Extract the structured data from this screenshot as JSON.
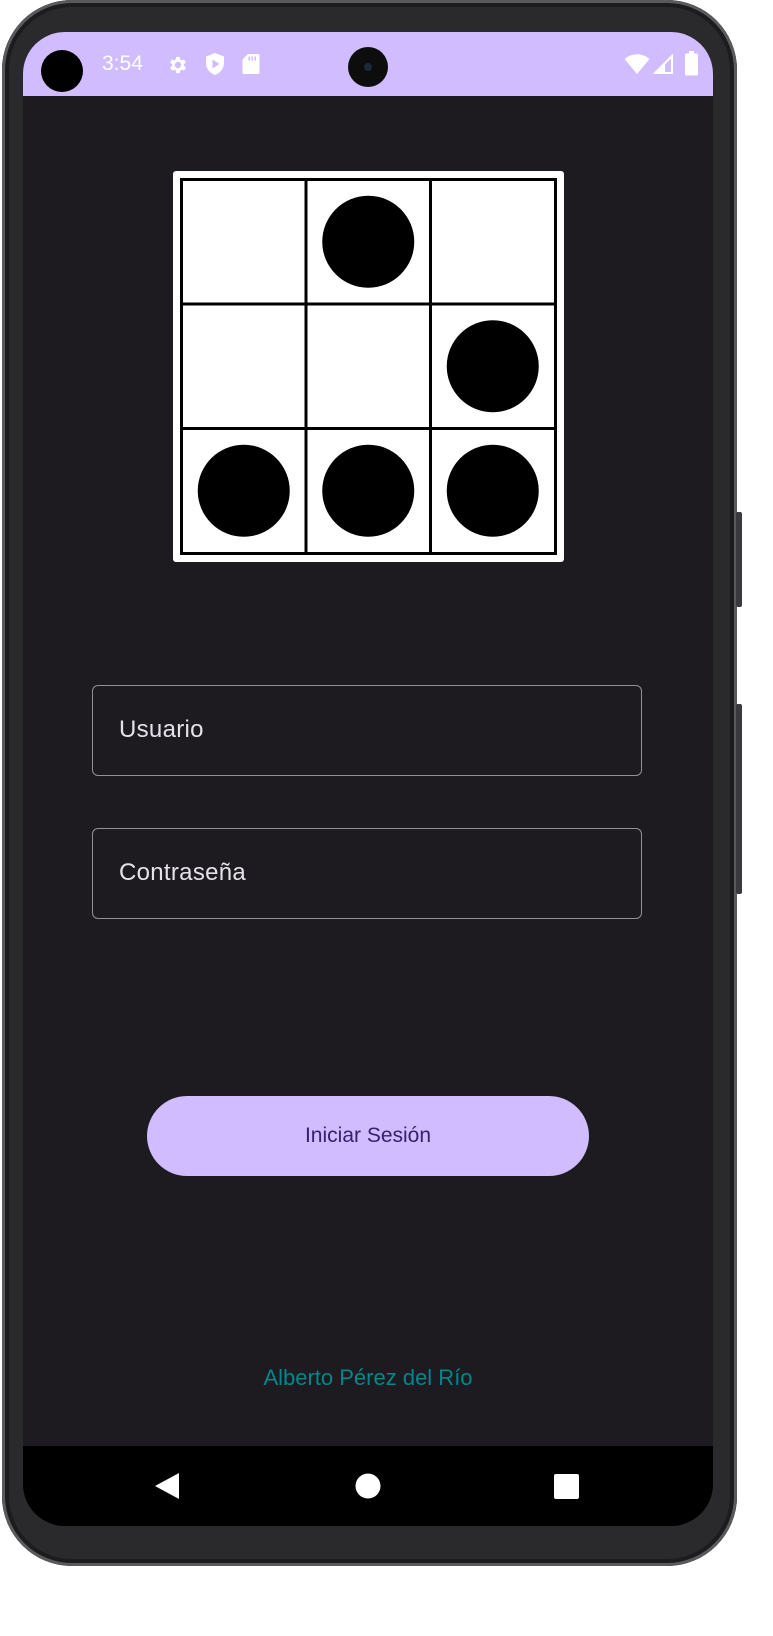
{
  "status_bar": {
    "time": "3:54",
    "color": "#d0bcff",
    "left_icons": [
      "settings-icon",
      "shield-play-icon",
      "sd-card-icon"
    ],
    "right_icons": [
      "wifi-icon",
      "signal-icon",
      "battery-icon"
    ]
  },
  "logo": {
    "name": "glider-emblem",
    "grid": [
      [
        0,
        1,
        0
      ],
      [
        0,
        0,
        1
      ],
      [
        1,
        1,
        1
      ]
    ]
  },
  "form": {
    "username_label": "Usuario",
    "password_label": "Contraseña"
  },
  "login_button": {
    "label": "Iniciar Sesión",
    "color": "#d0bcff",
    "text_color": "#381e72"
  },
  "footer": {
    "author": "Alberto Pérez del Río",
    "color": "#00868b"
  },
  "nav_bar": {
    "items": [
      "back-icon",
      "home-icon",
      "recents-icon"
    ]
  }
}
